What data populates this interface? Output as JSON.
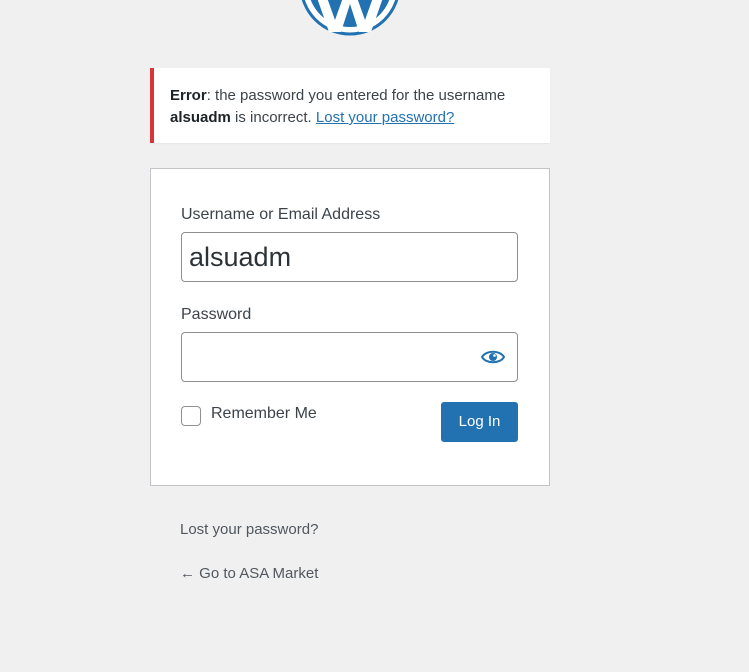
{
  "brand": {
    "logo_icon": "wordpress-logo-icon",
    "accent_color": "#2271b1",
    "error_color": "#d63638"
  },
  "error": {
    "prefix": "Error",
    "message_part1": ": the password you entered for the username",
    "username": "alsuadm",
    "message_part2": " is incorrect. ",
    "link_text": "Lost your password?"
  },
  "form": {
    "username_label": "Username or Email Address",
    "username_value": "alsuadm",
    "password_label": "Password",
    "password_value": "",
    "show_password_icon": "eye-icon",
    "remember_label": "Remember Me",
    "remember_checked": false,
    "login_button": "Log In"
  },
  "footer": {
    "lost_password": "Lost your password?",
    "back_link": "← Go to ASA Market"
  }
}
